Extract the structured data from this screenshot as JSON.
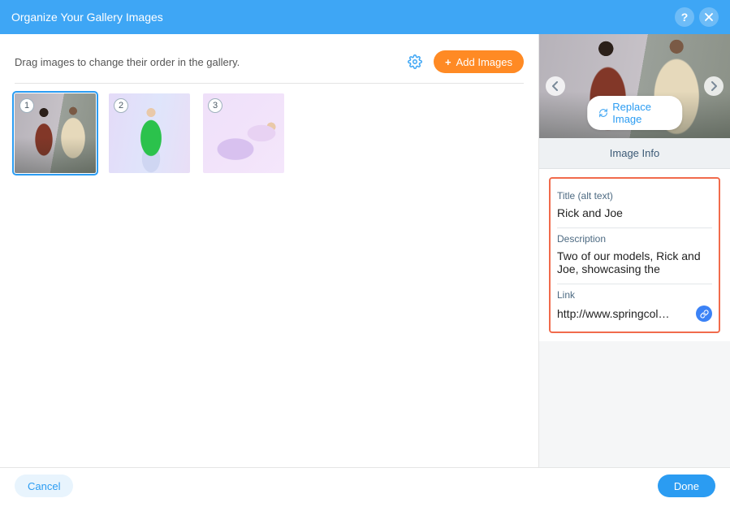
{
  "header": {
    "title": "Organize Your Gallery Images"
  },
  "toolbar": {
    "instruction": "Drag images to change their order in the gallery.",
    "add_label": "Add Images"
  },
  "thumbs": [
    {
      "num": "1",
      "selected": true
    },
    {
      "num": "2",
      "selected": false
    },
    {
      "num": "3",
      "selected": false
    }
  ],
  "sidebar": {
    "replace_label": "Replace Image",
    "info_header": "Image Info",
    "title_label": "Title (alt text)",
    "title_value": "Rick and Joe",
    "desc_label": "Description",
    "desc_value": "Two of our models, Rick and Joe, showcasing the",
    "link_label": "Link",
    "link_value": "http://www.springcol…"
  },
  "footer": {
    "cancel": "Cancel",
    "done": "Done"
  }
}
